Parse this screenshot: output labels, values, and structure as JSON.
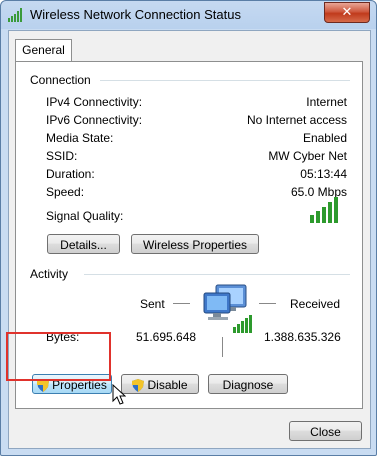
{
  "window": {
    "title": "Wireless Network Connection Status",
    "close_label": "✕"
  },
  "tabs": [
    {
      "label": "General"
    }
  ],
  "connection": {
    "group_label": "Connection",
    "rows": [
      {
        "label": "IPv4 Connectivity:",
        "value": "Internet"
      },
      {
        "label": "IPv6 Connectivity:",
        "value": "No Internet access"
      },
      {
        "label": "Media State:",
        "value": "Enabled"
      },
      {
        "label": "SSID:",
        "value": "MW Cyber Net"
      },
      {
        "label": "Duration:",
        "value": "05:13:44"
      },
      {
        "label": "Speed:",
        "value": "65.0 Mbps"
      }
    ],
    "signal_label": "Signal Quality:",
    "signal_bars_lit": 5,
    "signal_bars_total": 5,
    "details_button": "Details...",
    "wireless_properties_button": "Wireless Properties"
  },
  "activity": {
    "group_label": "Activity",
    "sent_label": "Sent",
    "received_label": "Received",
    "bytes_label": "Bytes:",
    "bytes_sent": "51.695.648",
    "bytes_received": "1.388.635.326",
    "properties_button": "Properties",
    "disable_button": "Disable",
    "diagnose_button": "Diagnose"
  },
  "footer": {
    "close_button": "Close"
  },
  "colors": {
    "accent": "#3c7fb1",
    "highlight_box": "#e0322c",
    "signal_green": "#2d9a2d"
  },
  "icons": [
    "wifi-signal-icon",
    "network-computers-icon",
    "uac-shield-icon",
    "mouse-cursor-icon"
  ]
}
